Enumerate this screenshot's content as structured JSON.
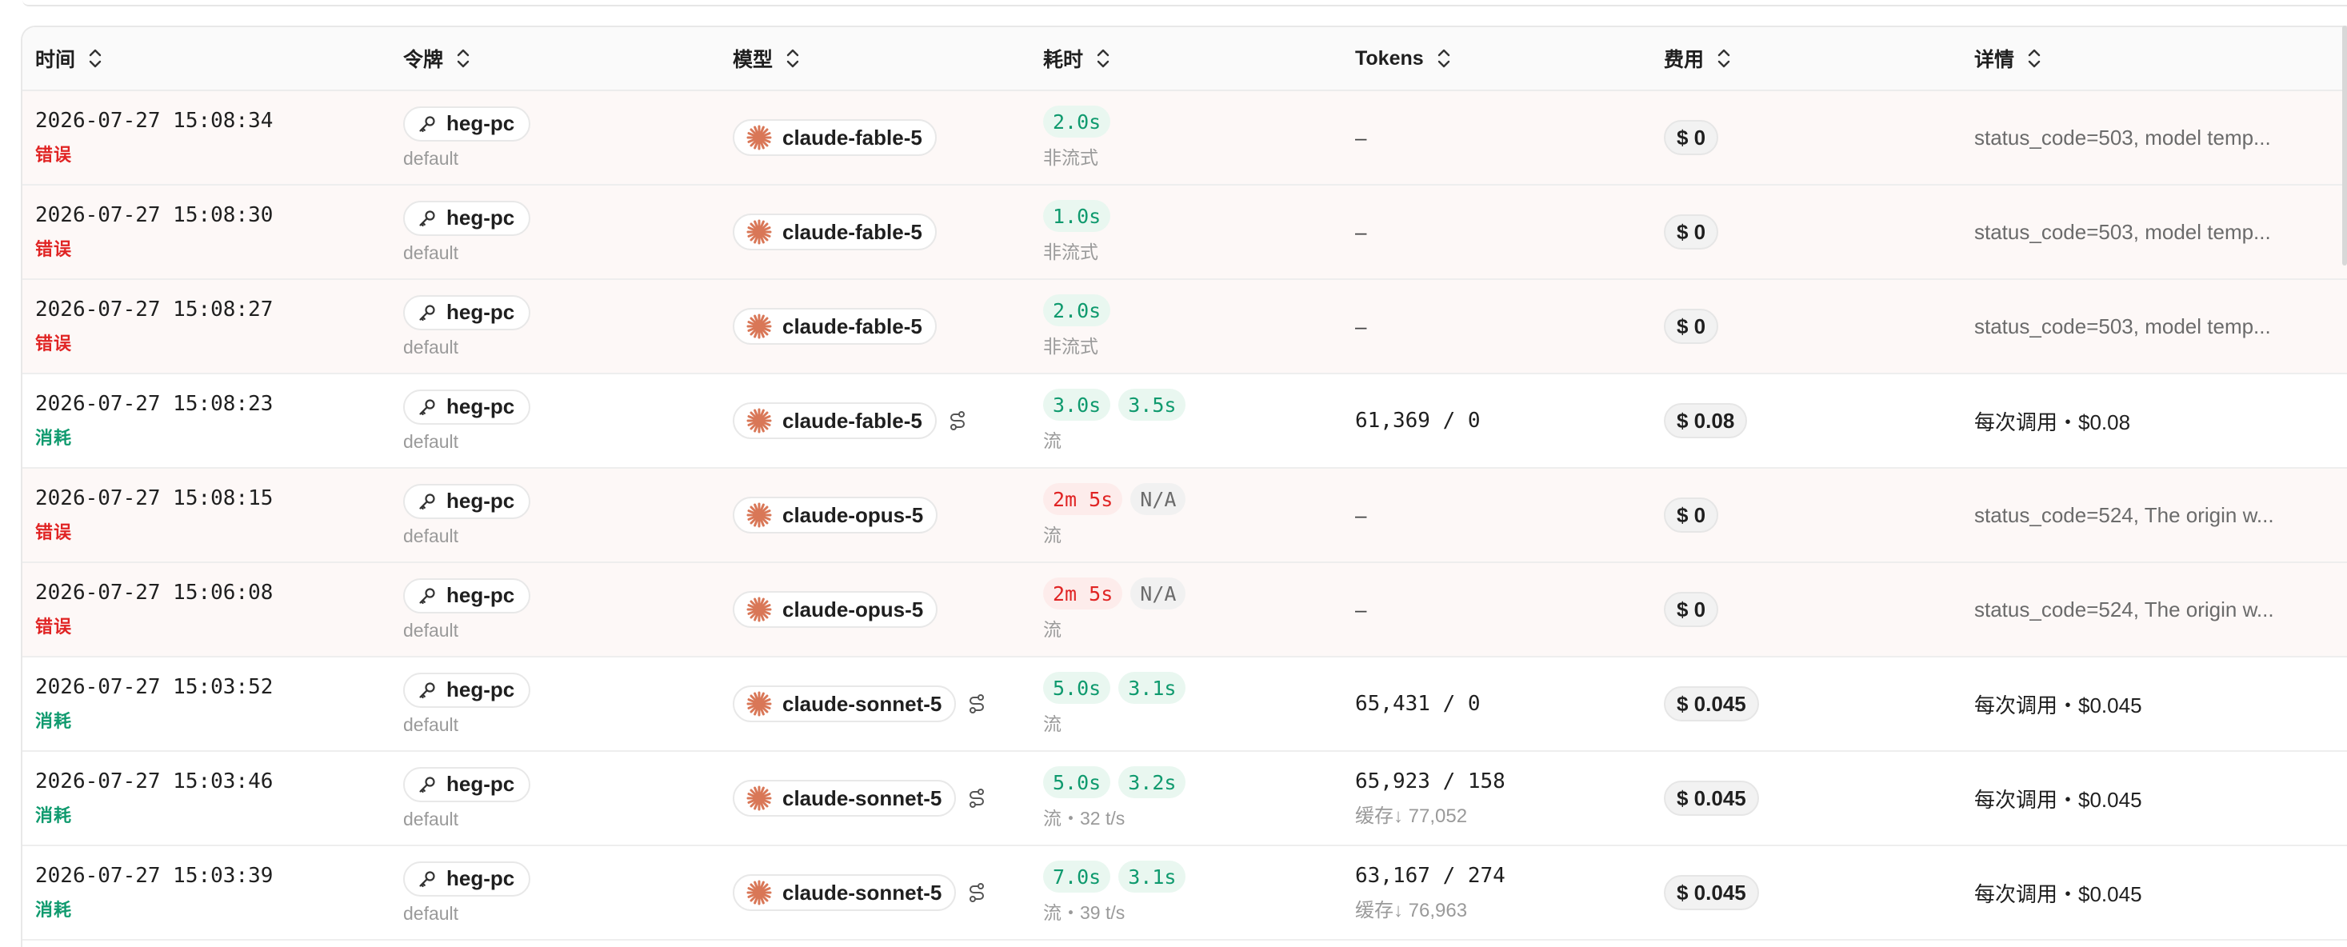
{
  "headers": {
    "time": "时间",
    "token": "令牌",
    "model": "模型",
    "duration": "耗时",
    "tokens": "Tokens",
    "cost": "费用",
    "detail": "详情"
  },
  "colors": {
    "error": "#e02424",
    "success": "#0f9a6e",
    "claude_brand": "#d97757"
  },
  "icons": {
    "token": "key-icon",
    "model": "claude-icon",
    "route": "route-icon",
    "sort": "sort-icon"
  },
  "rows": [
    {
      "time": "2026-07-27 15:08:34",
      "status": "错误",
      "state": "error",
      "token": "heg-pc",
      "group": "default",
      "model": "claude-fable-5",
      "route": false,
      "dur1": "2.0s",
      "dur2": "",
      "dur_sub": "非流式",
      "tokens": "–",
      "tokens_sub": "",
      "cost": "$ 0",
      "detail": "status_code=503, model temp..."
    },
    {
      "time": "2026-07-27 15:08:30",
      "status": "错误",
      "state": "error",
      "token": "heg-pc",
      "group": "default",
      "model": "claude-fable-5",
      "route": false,
      "dur1": "1.0s",
      "dur2": "",
      "dur_sub": "非流式",
      "tokens": "–",
      "tokens_sub": "",
      "cost": "$ 0",
      "detail": "status_code=503, model temp..."
    },
    {
      "time": "2026-07-27 15:08:27",
      "status": "错误",
      "state": "error",
      "token": "heg-pc",
      "group": "default",
      "model": "claude-fable-5",
      "route": false,
      "dur1": "2.0s",
      "dur2": "",
      "dur_sub": "非流式",
      "tokens": "–",
      "tokens_sub": "",
      "cost": "$ 0",
      "detail": "status_code=503, model temp..."
    },
    {
      "time": "2026-07-27 15:08:23",
      "status": "消耗",
      "state": "ok",
      "token": "heg-pc",
      "group": "default",
      "model": "claude-fable-5",
      "route": true,
      "dur1": "3.0s",
      "dur2": "3.5s",
      "dur_sub": "流",
      "tokens": "61,369 / 0",
      "tokens_sub": "",
      "cost": "$ 0.08",
      "detail": "每次调用・$0.08"
    },
    {
      "time": "2026-07-27 15:08:15",
      "status": "错误",
      "state": "error",
      "token": "heg-pc",
      "group": "default",
      "model": "claude-opus-5",
      "route": false,
      "dur1": "2m 5s",
      "dur2": "N/A",
      "dur_sub": "流",
      "tokens": "–",
      "tokens_sub": "",
      "cost": "$ 0",
      "detail": "status_code=524, The origin w..."
    },
    {
      "time": "2026-07-27 15:06:08",
      "status": "错误",
      "state": "error",
      "token": "heg-pc",
      "group": "default",
      "model": "claude-opus-5",
      "route": false,
      "dur1": "2m 5s",
      "dur2": "N/A",
      "dur_sub": "流",
      "tokens": "–",
      "tokens_sub": "",
      "cost": "$ 0",
      "detail": "status_code=524, The origin w..."
    },
    {
      "time": "2026-07-27 15:03:52",
      "status": "消耗",
      "state": "ok",
      "token": "heg-pc",
      "group": "default",
      "model": "claude-sonnet-5",
      "route": true,
      "dur1": "5.0s",
      "dur2": "3.1s",
      "dur_sub": "流",
      "tokens": "65,431 / 0",
      "tokens_sub": "",
      "cost": "$ 0.045",
      "detail": "每次调用・$0.045"
    },
    {
      "time": "2026-07-27 15:03:46",
      "status": "消耗",
      "state": "ok",
      "token": "heg-pc",
      "group": "default",
      "model": "claude-sonnet-5",
      "route": true,
      "dur1": "5.0s",
      "dur2": "3.2s",
      "dur_sub": "流・32 t/s",
      "tokens": "65,923 / 158",
      "tokens_sub": "缓存↓ 77,052",
      "cost": "$ 0.045",
      "detail": "每次调用・$0.045"
    },
    {
      "time": "2026-07-27 15:03:39",
      "status": "消耗",
      "state": "ok",
      "token": "heg-pc",
      "group": "default",
      "model": "claude-sonnet-5",
      "route": true,
      "dur1": "7.0s",
      "dur2": "3.1s",
      "dur_sub": "流・39 t/s",
      "tokens": "63,167 / 274",
      "tokens_sub": "缓存↓ 76,963",
      "cost": "$ 0.045",
      "detail": "每次调用・$0.045"
    }
  ]
}
